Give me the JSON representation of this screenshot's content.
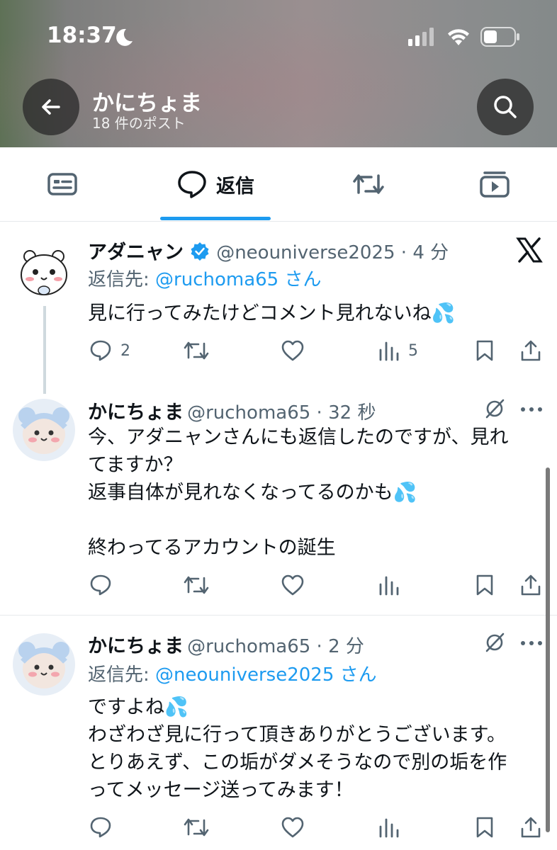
{
  "status_bar": {
    "time": "18:37"
  },
  "header": {
    "title": "かにちょま",
    "subtitle": "18 件のポスト"
  },
  "tabs": {
    "replies_label": "返信"
  },
  "posts": [
    {
      "name": "アダニャン",
      "handle": "@neouniverse2025",
      "time": "4 分",
      "reply_prefix": "返信先: ",
      "reply_handle": "@ruchoma65",
      "reply_suffix": " さん",
      "text": "見に行ってみたけどコメント見れないね💦",
      "replies": "2",
      "views": "5"
    },
    {
      "name": "かにちょま",
      "handle": "@ruchoma65",
      "time": "32 秒",
      "text": "今、アダニャンさんにも返信したのですが、見れ\nてますか？\n返事自体が見れなくなってるのかも💦\n\n終わってるアカウントの誕生"
    },
    {
      "name": "かにちょま",
      "handle": "@ruchoma65",
      "time": "2 分",
      "reply_prefix": "返信先: ",
      "reply_handle": "@neouniverse2025",
      "reply_suffix": " さん",
      "text": "ですよね💦\nわざわざ見に行って頂きありがとうございます。\nとりあえず、この垢がダメそうなので別の垢を作\nってメッセージ送ってみます！"
    }
  ],
  "colors": {
    "accent": "#1d9bf0",
    "text": "#0f1419",
    "muted": "#536471"
  }
}
